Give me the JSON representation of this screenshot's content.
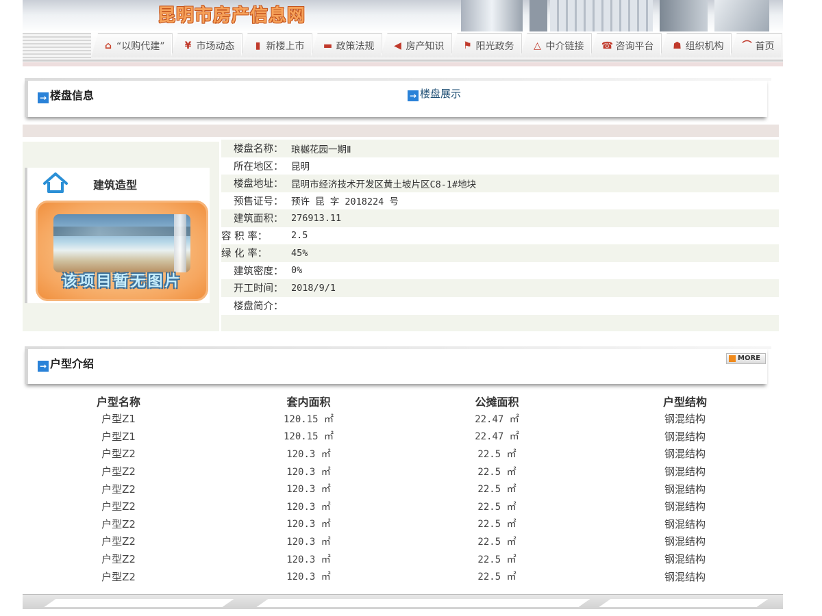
{
  "site": {
    "title": "昆明市房产信息网"
  },
  "nav": {
    "tabs": [
      {
        "label": "“以购代建”",
        "icon": "house-icon",
        "color": "#c8422b"
      },
      {
        "label": "市场动态",
        "icon": "yen-icon",
        "color": "#c0392b"
      },
      {
        "label": "新楼上市",
        "icon": "bar-chart-icon",
        "color": "#c0392b"
      },
      {
        "label": "政策法规",
        "icon": "book-icon",
        "color": "#c0392b"
      },
      {
        "label": "房产知识",
        "icon": "arrow-left-icon",
        "color": "#c0392b"
      },
      {
        "label": "阳光政务",
        "icon": "flag-icon",
        "color": "#c0392b"
      },
      {
        "label": "中介链接",
        "icon": "triangle-icon",
        "color": "#c0392b"
      },
      {
        "label": "咨询平台",
        "icon": "phone-icon",
        "color": "#c0392b"
      },
      {
        "label": "组织机构",
        "icon": "org-chart-icon",
        "color": "#c0392b"
      },
      {
        "label": "首页",
        "icon": "home-icon",
        "color": "#c0392b"
      }
    ]
  },
  "building_section": {
    "title": "楼盘信息",
    "link": "楼盘展示"
  },
  "architecture": {
    "title": "建筑造型",
    "no_image_text": "该项目暂无图片"
  },
  "info": {
    "rows": [
      {
        "label": "楼盘名称：",
        "value": "琅樾花园一期Ⅱ"
      },
      {
        "label": "所在地区：",
        "value": "昆明"
      },
      {
        "label": "楼盘地址：",
        "value": "昆明市经济技术开发区黄土坡片区C8-1#地块"
      },
      {
        "label": "预售证号：",
        "value": "预许 昆 字 2018224 号"
      },
      {
        "label": "建筑面积：",
        "value": "276913.11"
      },
      {
        "label": "容 积 率：",
        "value": "2.5",
        "wide": true
      },
      {
        "label": "绿 化 率：",
        "value": "45%",
        "wide": true
      },
      {
        "label": "建筑密度：",
        "value": "0%"
      },
      {
        "label": "开工时间：",
        "value": "2018/9/1"
      },
      {
        "label": "楼盘简介：",
        "value": ""
      }
    ]
  },
  "units_section": {
    "title": "户型介绍",
    "more_label": "MORE",
    "columns": [
      "户型名称",
      "套内面积",
      "公摊面积",
      "户型结构"
    ],
    "rows": [
      [
        "户型Z1",
        "120.15 ㎡",
        "22.47 ㎡",
        "钢混结构"
      ],
      [
        "户型Z1",
        "120.15 ㎡",
        "22.47 ㎡",
        "钢混结构"
      ],
      [
        "户型Z2",
        "120.3 ㎡",
        "22.5 ㎡",
        "钢混结构"
      ],
      [
        "户型Z2",
        "120.3 ㎡",
        "22.5 ㎡",
        "钢混结构"
      ],
      [
        "户型Z2",
        "120.3 ㎡",
        "22.5 ㎡",
        "钢混结构"
      ],
      [
        "户型Z2",
        "120.3 ㎡",
        "22.5 ㎡",
        "钢混结构"
      ],
      [
        "户型Z2",
        "120.3 ㎡",
        "22.5 ㎡",
        "钢混结构"
      ],
      [
        "户型Z2",
        "120.3 ㎡",
        "22.5 ㎡",
        "钢混结构"
      ],
      [
        "户型Z2",
        "120.3 ㎡",
        "22.5 ㎡",
        "钢混结构"
      ],
      [
        "户型Z2",
        "120.3 ㎡",
        "22.5 ㎡",
        "钢混结构"
      ]
    ]
  },
  "colors": {
    "accent_blue": "#2a82d8",
    "title_orange": "#f6a25a",
    "panel_bg": "#f2f4ec"
  }
}
